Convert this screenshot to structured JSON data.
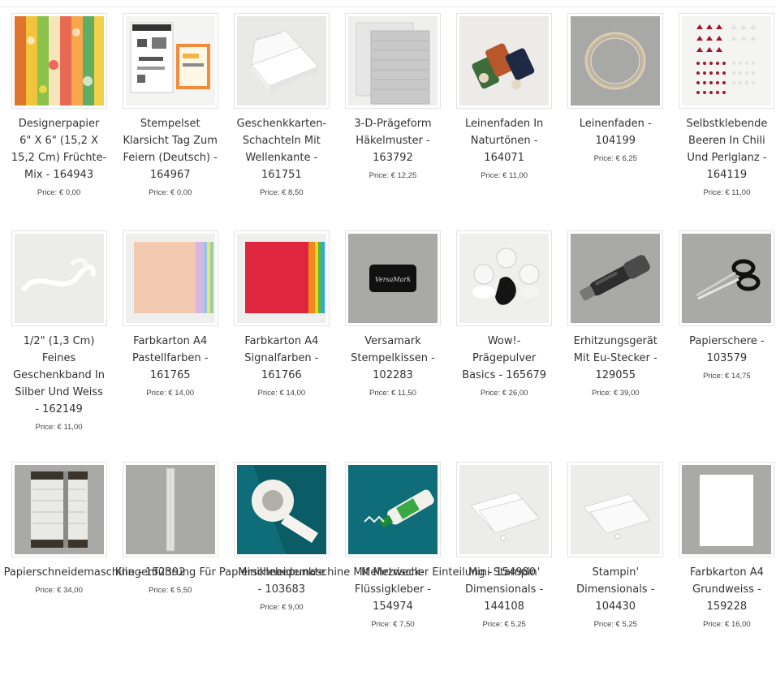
{
  "price_prefix": "Price:",
  "rows": [
    [
      {
        "title": "Designerpapier\n6\" X 6\" (15,2 X\n15,2 Cm) Früchte-\nMix - 164943",
        "price": "Price: € 0,00",
        "image": "fruit-designer-paper-thumbnail"
      },
      {
        "title": "Stempelset\nKlarsicht Tag Zum\nFeiern (Deutsch) -\n164967",
        "price": "Price: € 0,00",
        "image": "stamp-set-thumbnail"
      },
      {
        "title": "Geschenkkarten-\nSchachteln Mit\nWellenkante -\n161751",
        "price": "Price: € 8,50",
        "image": "gift-card-box-thumbnail"
      },
      {
        "title": "3-D-Prägeform\nHäkelmuster -\n163792",
        "price": "Price: € 12,25",
        "image": "embossing-folder-thumbnail"
      },
      {
        "title": "Leinenfaden In\nNaturtönen -\n164071",
        "price": "Price: € 11,00",
        "image": "linen-thread-spools-thumbnail"
      },
      {
        "title": "Leinenfaden -\n104199",
        "price": "Price: € 6,25",
        "image": "linen-thread-coil-thumbnail"
      },
      {
        "title": "Selbstklebende\nBeeren In Chili\nUnd Perlglanz -\n164119",
        "price": "Price: € 11,00",
        "image": "adhesive-berries-thumbnail"
      }
    ],
    [
      {
        "title": "1/2\" (1,3 Cm)\nFeines\nGeschenkband In\nSilber Und Weiss\n- 162149",
        "price": "Price: € 11,00",
        "image": "ribbon-thumbnail"
      },
      {
        "title": "Farbkarton A4\nPastellfarben -\n161765",
        "price": "Price: € 14,00",
        "image": "pastel-cardstock-thumbnail"
      },
      {
        "title": "Farbkarton A4\nSignalfarben -\n161766",
        "price": "Price: € 14,00",
        "image": "bright-cardstock-thumbnail"
      },
      {
        "title": "Versamark\nStempelkissen -\n102283",
        "price": "Price: € 11,50",
        "image": "versamark-pad-thumbnail"
      },
      {
        "title": "Wow!-\nPrägepulver\nBasics - 165679",
        "price": "Price: € 26,00",
        "image": "embossing-powder-thumbnail"
      },
      {
        "title": "Erhitzungsgerät\nMit Eu-Stecker -\n129055",
        "price": "Price: € 39,00",
        "image": "heat-tool-thumbnail"
      },
      {
        "title": "Papierschere -\n103579",
        "price": "Price: € 14,75",
        "image": "scissors-thumbnail"
      }
    ],
    [
      {
        "title": "Papierschneidemaschine\n- 152392",
        "price": "Price: € 34,00",
        "image": "paper-trimmer-thumbnail"
      },
      {
        "title": "Klingenführung\nFür\nPapierschneidemaschine\nMit Metrischer\nEinteilung -\n154980",
        "price": "Price: € 5,50",
        "image": "blade-guide-thumbnail"
      },
      {
        "title": "Miniklebepunkte\n- 103683",
        "price": "Price: € 9,00",
        "image": "mini-glue-dots-thumbnail"
      },
      {
        "title": "Mehrzweck-\nFlüssigkleber -\n154974",
        "price": "Price: € 7,50",
        "image": "liquid-glue-thumbnail"
      },
      {
        "title": "Mini Stampin'\nDimensionals -\n144108",
        "price": "Price: € 5,25",
        "image": "mini-dimensionals-thumbnail"
      },
      {
        "title": "Stampin'\nDimensionals -\n104430",
        "price": "Price: € 5,25",
        "image": "dimensionals-thumbnail"
      },
      {
        "title": "Farbkarton A4\nGrundweiss -\n159228",
        "price": "Price: € 16,00",
        "image": "white-cardstock-thumbnail"
      }
    ]
  ]
}
